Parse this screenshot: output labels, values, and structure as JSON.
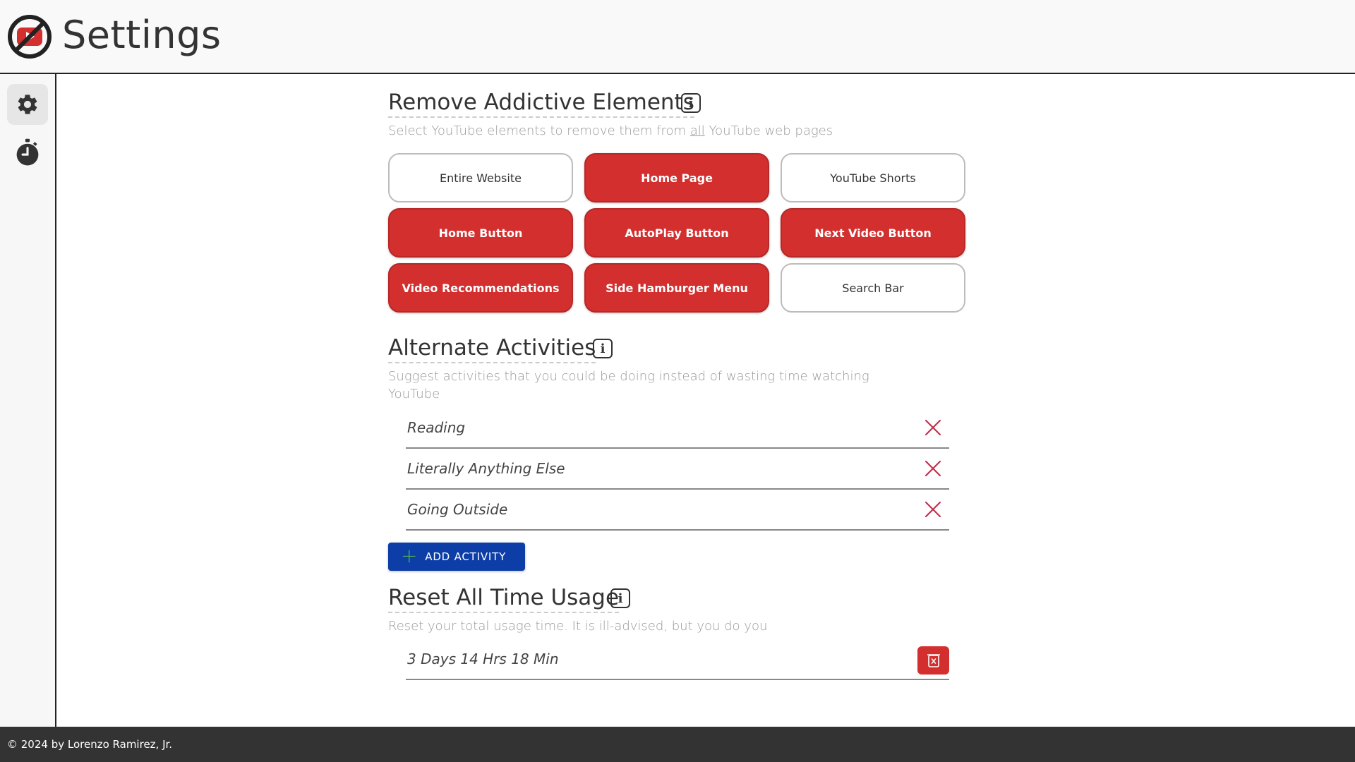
{
  "header": {
    "title": "Settings",
    "logo_icon": "youtube-blocked-logo"
  },
  "sidebar": {
    "items": [
      {
        "icon": "gear-icon",
        "active": true
      },
      {
        "icon": "stopwatch-icon",
        "active": false
      }
    ]
  },
  "remove_section": {
    "title": "Remove Addictive Elements",
    "desc_before": "Select YouTube elements to remove them from ",
    "desc_em": "all",
    "desc_after": " YouTube web pages",
    "tiles": [
      {
        "label": "Entire Website",
        "selected": false
      },
      {
        "label": "Home Page",
        "selected": true
      },
      {
        "label": "YouTube Shorts",
        "selected": false
      },
      {
        "label": "Home Button",
        "selected": true
      },
      {
        "label": "AutoPlay Button",
        "selected": true
      },
      {
        "label": "Next Video Button",
        "selected": true
      },
      {
        "label": "Video Recommendations",
        "selected": true
      },
      {
        "label": "Side Hamburger Menu",
        "selected": true
      },
      {
        "label": "Search Bar",
        "selected": false
      }
    ]
  },
  "activities_section": {
    "title": "Alternate Activities",
    "desc_line1": "Suggest activities that you could be doing instead of wasting time watching",
    "desc_line2": "YouTube",
    "items": [
      "Reading",
      "Literally Anything Else",
      "Going Outside"
    ],
    "add_label": "ADD ACTIVITY"
  },
  "reset_section": {
    "title": "Reset All Time Usage",
    "desc": "Reset your total usage time. It is ill-advised, but you do you",
    "usage_value": "3 Days 14 Hrs 18 Min"
  },
  "footer": {
    "text": "© 2024 by Lorenzo Ramirez, Jr."
  },
  "colors": {
    "accent_red": "#d32f2f",
    "button_blue": "#0d3ea8",
    "footer_bg": "#333333"
  }
}
